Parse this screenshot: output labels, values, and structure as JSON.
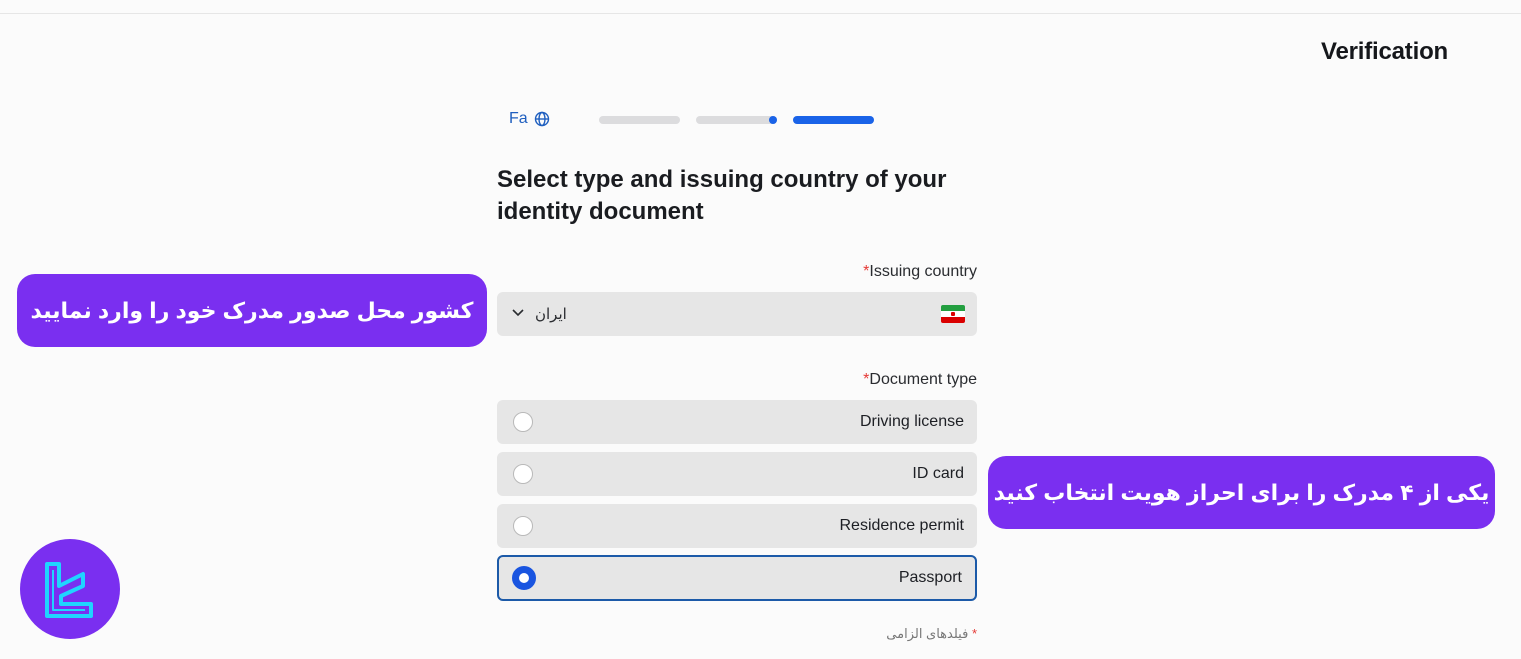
{
  "header": {
    "title": "Verification"
  },
  "language": {
    "label": "Fa",
    "icon": "globe-icon"
  },
  "progress": {
    "total_steps": 3,
    "current_step": 3
  },
  "form": {
    "heading": "Select type and issuing country of your identity document",
    "country_label": "Issuing country",
    "required_mark": "*",
    "country_value": "ایران",
    "document_type_label": "Document type",
    "document_options": [
      {
        "label": "Driving license",
        "selected": false
      },
      {
        "label": "ID card",
        "selected": false
      },
      {
        "label": "Residence permit",
        "selected": false
      },
      {
        "label": "Passport",
        "selected": true
      }
    ],
    "required_note": "فیلدهای الزامی"
  },
  "callouts": {
    "country": "کشور محل صدور مدرک خود را وارد نمایید",
    "document": "یکی از ۴ مدرک را برای احراز هویت انتخاب کنید"
  },
  "colors": {
    "accent": "#1a63e8",
    "callout": "#7a2ff0",
    "required": "#e53935",
    "logo": "#1fd4ff"
  }
}
